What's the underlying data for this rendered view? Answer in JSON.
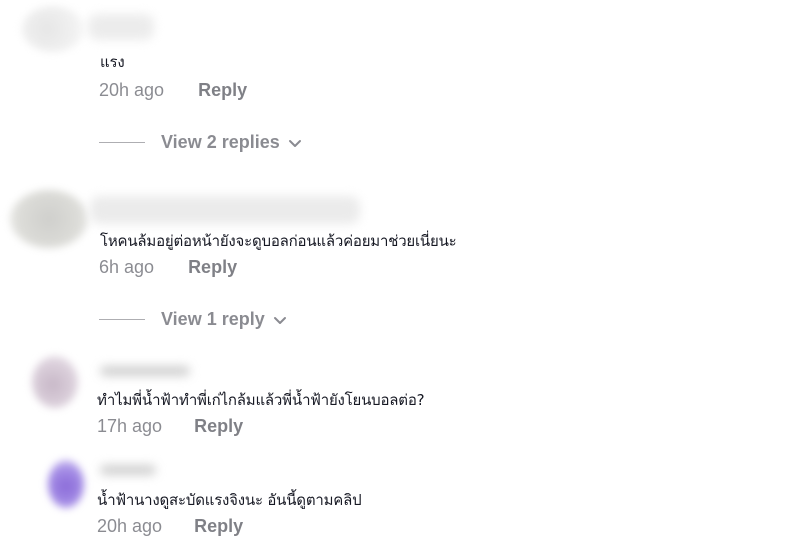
{
  "comments": [
    {
      "text": "แรง",
      "time": "20h ago",
      "reply_label": "Reply",
      "view_replies_label": "View 2 replies"
    },
    {
      "text": "โหคนล้มอยู่ต่อหน้ายังจะดูบอลก่อนแล้วค่อยมาช่วยเนี่ยนะ",
      "time": "6h ago",
      "reply_label": "Reply",
      "view_replies_label": "View 1 reply"
    },
    {
      "text": "ทำไมพี่น้ำฟ้าทำพี่เก่ไกล้มแล้วพี่น้ำฟ้ายังโยนบอลต่อ?",
      "time": "17h ago",
      "reply_label": "Reply"
    },
    {
      "text": "น้ำฟ้านางดูสะบัดแรงจิงนะ อันนี้ดูตามคลิป",
      "time": "20h ago",
      "reply_label": "Reply"
    }
  ],
  "colors": {
    "text_primary": "#161823",
    "text_secondary": "#8a8b91",
    "avatar_4": "#9a7ee0"
  }
}
